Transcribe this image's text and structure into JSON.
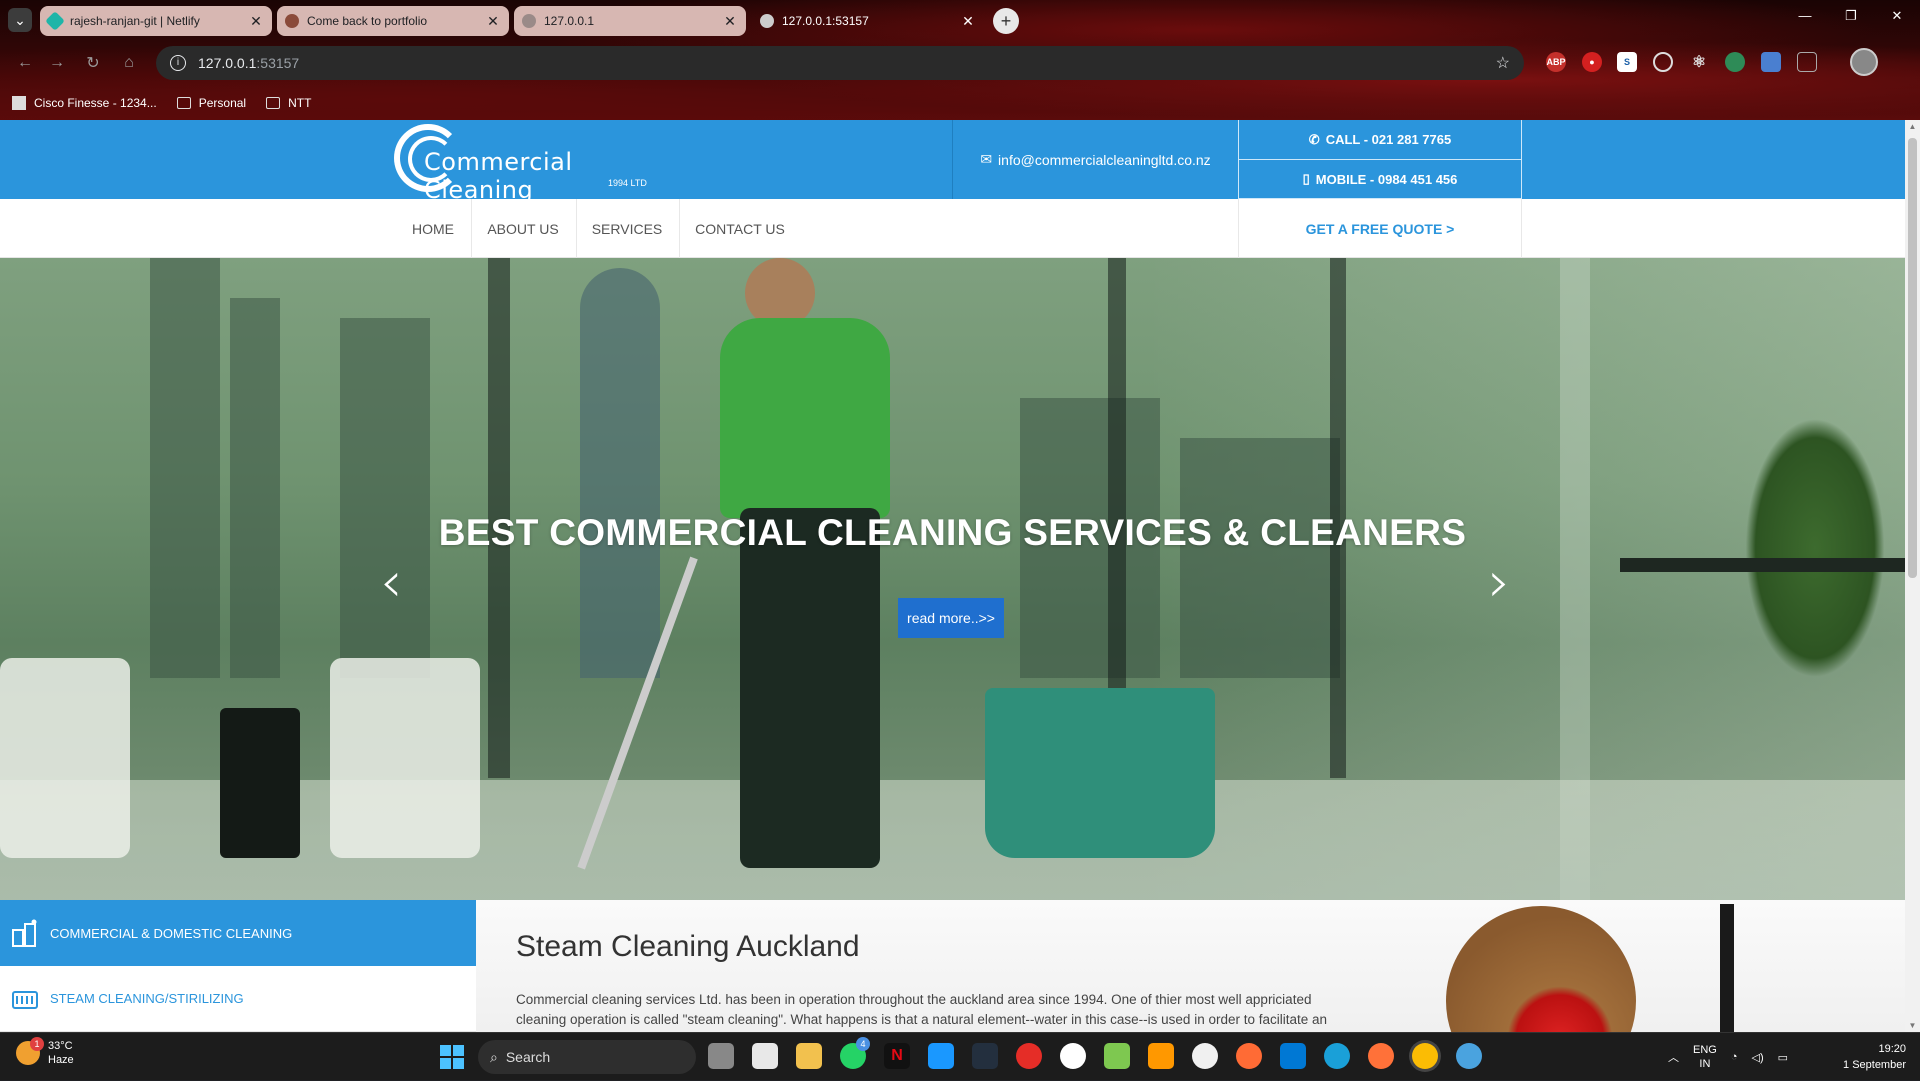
{
  "browser": {
    "tabs": [
      {
        "title": "rajesh-ranjan-git | Netlify",
        "favicon_color": "#1fb5a8",
        "active": false
      },
      {
        "title": "Come back to portfolio",
        "favicon_color": "#8a4a3a",
        "active": false
      },
      {
        "title": "127.0.0.1",
        "favicon_color": "#9a8a88",
        "active": false
      },
      {
        "title": "127.0.0.1:53157",
        "favicon_color": "#cccccc",
        "active": true
      }
    ],
    "address": {
      "host": "127.0.0.1",
      "port": ":53157"
    },
    "bookmarks": [
      "Cisco Finesse - 1234...",
      "Personal",
      "NTT"
    ],
    "window_controls": [
      "—",
      "❐",
      "✕"
    ]
  },
  "site": {
    "logo_name": "Commercial Cleaning",
    "logo_sub": "1994 LTD",
    "email": "info@commercialcleaningltd.co.nz",
    "call": "CALL - 021 281 7765",
    "mobile": "MOBILE - 0984 451 456",
    "nav": [
      "HOME",
      "ABOUT US",
      "SERVICES",
      "CONTACT US"
    ],
    "quote": "GET A FREE QUOTE >",
    "hero_title": "BEST COMMERCIAL CLEANING SERVICES & CLEANERS",
    "hero_button": "read more..>>",
    "services": [
      {
        "label": "COMMERCIAL & DOMESTIC CLEANING",
        "icon": "building-cleaning-icon",
        "active": true
      },
      {
        "label": "STEAM CLEANING/STIRILIZING",
        "icon": "steam-cleaner-icon",
        "active": false
      }
    ],
    "content_title": "Steam Cleaning Auckland",
    "content_text": "Commercial cleaning services Ltd. has been in operation throughout the auckland area since 1994. One of thier most well appriciated cleaning operation is called \"steam cleaning\". What happens is that a natural element--water in this case--is used in order to facilitate an",
    "accent_color": "#2b95dc"
  },
  "taskbar": {
    "weather_temp": "33°C",
    "weather_desc": "Haze",
    "weather_badge": "1",
    "search_placeholder": "Search",
    "whatsapp_badge": "4",
    "lang_top": "ENG",
    "lang_bottom": "IN",
    "time": "19:20",
    "date": "1 September"
  }
}
